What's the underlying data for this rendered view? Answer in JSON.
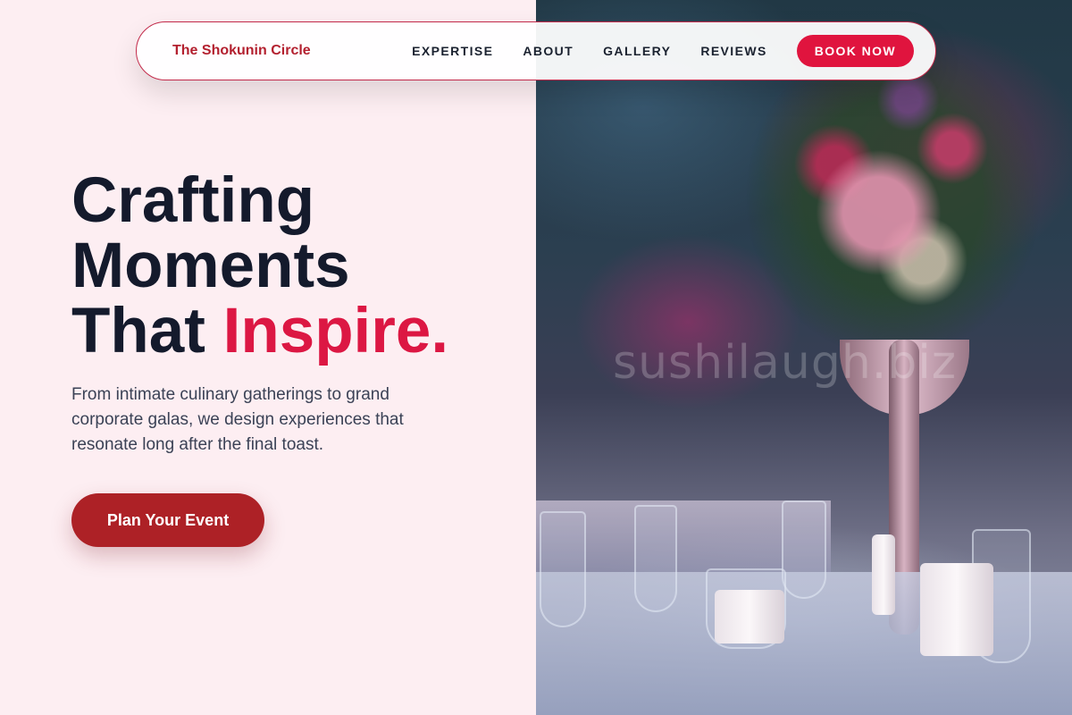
{
  "nav": {
    "brand": "The Shokunin Circle",
    "links": [
      "EXPERTISE",
      "ABOUT",
      "GALLERY",
      "REVIEWS"
    ],
    "cta": "BOOK NOW"
  },
  "hero": {
    "title_line1": "Crafting",
    "title_line2": "Moments",
    "title_line3_plain": "That",
    "title_line3_accent": "Inspire.",
    "description": "From intimate culinary gatherings to grand corporate galas, we design experiences that resonate long after the final toast.",
    "cta": "Plan Your Event"
  },
  "image": {
    "watermark": "sushilaugh.biz"
  },
  "colors": {
    "accent": "#dc1743",
    "brand": "#b3202f",
    "cta_dark": "#ad2126",
    "background": "#fdeef2",
    "heading": "#141a2c"
  }
}
